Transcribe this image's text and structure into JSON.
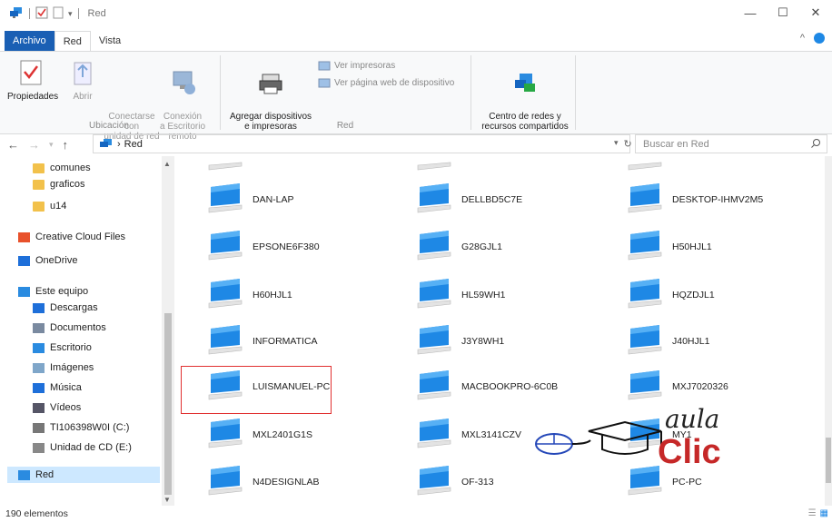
{
  "window": {
    "title": "Red"
  },
  "tabs": {
    "file": "Archivo",
    "red": "Red",
    "vista": "Vista"
  },
  "ribbon": {
    "propiedades": "Propiedades",
    "abrir": "Abrir",
    "conectarse": "Conectarse con\nunidad de red",
    "conexion": "Conexión\na Escritorio remoto",
    "ubicacion_group": "Ubicación",
    "agregar": "Agregar dispositivos\ne impresoras",
    "ver_impresoras": "Ver impresoras",
    "ver_pagina": "Ver página web de dispositivo",
    "red_group": "Red",
    "centro": "Centro de redes y\nrecursos compartidos"
  },
  "address": {
    "path": "Red",
    "search_placeholder": "Buscar en Red"
  },
  "navpane": [
    {
      "label": "comunes",
      "icon": "folder-icon"
    },
    {
      "label": "graficos",
      "icon": "folder-icon"
    },
    {
      "label": "u14",
      "icon": "folder-icon"
    },
    {
      "label": "Creative Cloud Files",
      "icon": "creative-cloud-icon"
    },
    {
      "label": "OneDrive",
      "icon": "onedrive-icon"
    },
    {
      "label": "Este equipo",
      "icon": "computer-icon"
    },
    {
      "label": "Descargas",
      "icon": "download-icon"
    },
    {
      "label": "Documentos",
      "icon": "documents-icon"
    },
    {
      "label": "Escritorio",
      "icon": "desktop-icon"
    },
    {
      "label": "Imágenes",
      "icon": "pictures-icon"
    },
    {
      "label": "Música",
      "icon": "music-icon"
    },
    {
      "label": "Vídeos",
      "icon": "videos-icon"
    },
    {
      "label": "TI106398W0I (C:)",
      "icon": "drive-icon"
    },
    {
      "label": "Unidad de CD (E:)",
      "icon": "cd-drive-icon"
    },
    {
      "label": "Red",
      "icon": "network-icon"
    }
  ],
  "computers": [
    [
      "DAN-LAP",
      "DELLBD5C7E",
      "DESKTOP-IHMV2M5"
    ],
    [
      "EPSONE6F380",
      "G28GJL1",
      "H50HJL1"
    ],
    [
      "H60HJL1",
      "HL59WH1",
      "HQZDJL1"
    ],
    [
      "INFORMATICA",
      "J3Y8WH1",
      "J40HJL1"
    ],
    [
      "LUISMANUEL-PC",
      "MACBOOKPRO-6C0B",
      "MXJ7020326"
    ],
    [
      "MXL2401G1S",
      "MXL3141CZV",
      "MY1"
    ],
    [
      "N4DESIGNLAB",
      "OF-313",
      "PC-PC"
    ]
  ],
  "status": {
    "count": "190 elementos"
  },
  "logo": {
    "line1": "aula",
    "line2": "Clic"
  }
}
